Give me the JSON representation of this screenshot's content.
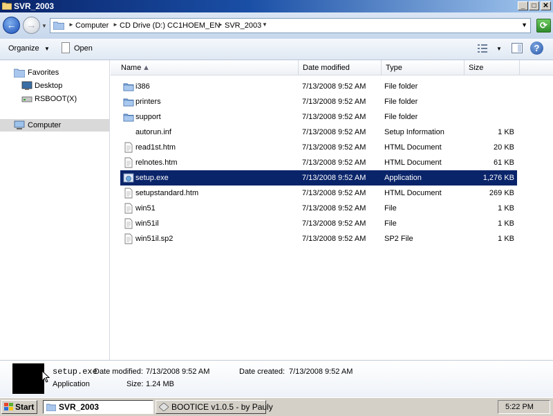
{
  "window": {
    "title": "SVR_2003"
  },
  "window_buttons": {
    "minimize": "_",
    "maximize": "□",
    "close": "✕"
  },
  "address_bar": {
    "crumbs": [
      "Computer",
      "CD Drive (D:) CC1HOEM_EN",
      "SVR_2003"
    ]
  },
  "toolbar": {
    "organize_label": "Organize",
    "open_label": "Open",
    "help_label": "?"
  },
  "nav_pane": {
    "items": [
      {
        "label": "Favorites",
        "icon": "favorites-folder-icon"
      },
      {
        "label": "Desktop",
        "icon": "desktop-icon"
      },
      {
        "label": "RSBOOT(X)",
        "icon": "drive-icon"
      },
      {
        "label": "Computer",
        "icon": "computer-icon",
        "selected": true
      }
    ]
  },
  "file_list": {
    "columns": [
      "Name",
      "Date modified",
      "Type",
      "Size"
    ],
    "rows": [
      {
        "name": "i386",
        "date": "7/13/2008 9:52 AM",
        "type": "File folder",
        "size": "",
        "icon": "folder-icon"
      },
      {
        "name": "printers",
        "date": "7/13/2008 9:52 AM",
        "type": "File folder",
        "size": "",
        "icon": "folder-icon"
      },
      {
        "name": "support",
        "date": "7/13/2008 9:52 AM",
        "type": "File folder",
        "size": "",
        "icon": "folder-icon"
      },
      {
        "name": "autorun.inf",
        "date": "7/13/2008 9:52 AM",
        "type": "Setup Information",
        "size": "1 KB",
        "icon": "setup-info-icon"
      },
      {
        "name": "read1st.htm",
        "date": "7/13/2008 9:52 AM",
        "type": "HTML Document",
        "size": "20 KB",
        "icon": "document-icon"
      },
      {
        "name": "relnotes.htm",
        "date": "7/13/2008 9:52 AM",
        "type": "HTML Document",
        "size": "61 KB",
        "icon": "document-icon"
      },
      {
        "name": "setup.exe",
        "date": "7/13/2008 9:52 AM",
        "type": "Application",
        "size": "1,276 KB",
        "icon": "application-icon",
        "selected": true
      },
      {
        "name": "setupstandard.htm",
        "date": "7/13/2008 9:52 AM",
        "type": "HTML Document",
        "size": "269 KB",
        "icon": "document-icon"
      },
      {
        "name": "win51",
        "date": "7/13/2008 9:52 AM",
        "type": "File",
        "size": "1 KB",
        "icon": "document-icon"
      },
      {
        "name": "win51il",
        "date": "7/13/2008 9:52 AM",
        "type": "File",
        "size": "1 KB",
        "icon": "document-icon"
      },
      {
        "name": "win51il.sp2",
        "date": "7/13/2008 9:52 AM",
        "type": "SP2 File",
        "size": "1 KB",
        "icon": "document-icon"
      }
    ]
  },
  "details_pane": {
    "filename": "setup.exe",
    "date_modified_label": "Date modified:",
    "date_modified": "7/13/2008 9:52 AM",
    "date_created_label": "Date created:",
    "date_created": "7/13/2008 9:52 AM",
    "type": "Application",
    "size_label": "Size:",
    "size": "1.24 MB"
  },
  "taskbar": {
    "start_label": "Start",
    "tasks": [
      {
        "label": "SVR_2003",
        "active": true
      },
      {
        "label": "BOOTICE v1.0.5 - by Pauly",
        "active": false
      }
    ],
    "clock": "5:22 PM"
  },
  "colors": {
    "selection": "#0a246a",
    "title_gradient_start": "#0a246a",
    "title_gradient_end": "#a6caf0"
  }
}
